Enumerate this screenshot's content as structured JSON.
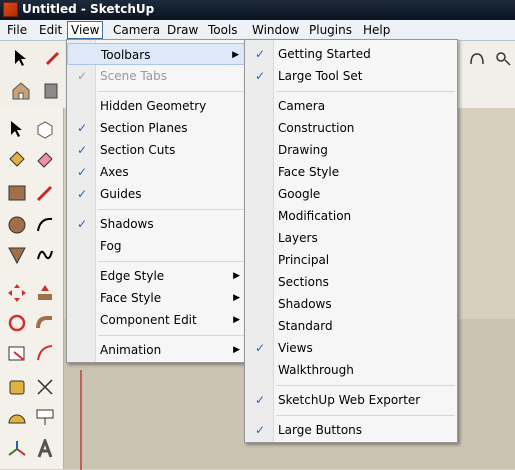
{
  "window": {
    "title": "Untitled - SketchUp"
  },
  "menubar": {
    "items": [
      "File",
      "Edit",
      "View",
      "Camera",
      "Draw",
      "Tools",
      "Window",
      "Plugins",
      "Help"
    ],
    "active": "View"
  },
  "view_menu": {
    "toolbars": "Toolbars",
    "scene_tabs": "Scene Tabs",
    "hidden_geometry": "Hidden Geometry",
    "section_planes": "Section Planes",
    "section_cuts": "Section Cuts",
    "axes": "Axes",
    "guides": "Guides",
    "shadows": "Shadows",
    "fog": "Fog",
    "edge_style": "Edge Style",
    "face_style": "Face Style",
    "component_edit": "Component Edit",
    "animation": "Animation"
  },
  "toolbars_submenu": {
    "getting_started": "Getting Started",
    "large_tool_set": "Large Tool Set",
    "camera": "Camera",
    "construction": "Construction",
    "drawing": "Drawing",
    "face_style": "Face Style",
    "google": "Google",
    "modification": "Modification",
    "layers": "Layers",
    "principal": "Principal",
    "sections": "Sections",
    "shadows": "Shadows",
    "standard": "Standard",
    "views": "Views",
    "walkthrough": "Walkthrough",
    "web_exporter": "SketchUp Web Exporter",
    "large_buttons": "Large Buttons"
  },
  "checkmark": "✓",
  "arrow": "▶",
  "palette_icons": [
    "select-icon",
    "eraser-icon",
    "paint-bucket-icon",
    "rectangle-icon",
    "pencil-icon",
    "circle-icon",
    "arc-icon",
    "polygon-icon",
    "freehand-icon",
    "move-icon",
    "push-pull-icon",
    "rotate-icon",
    "follow-me-icon",
    "scale-icon",
    "offset-icon",
    "tape-measure-icon",
    "dimension-icon",
    "protractor-icon",
    "text-icon",
    "axes-tool-icon",
    "3d-text-icon"
  ]
}
